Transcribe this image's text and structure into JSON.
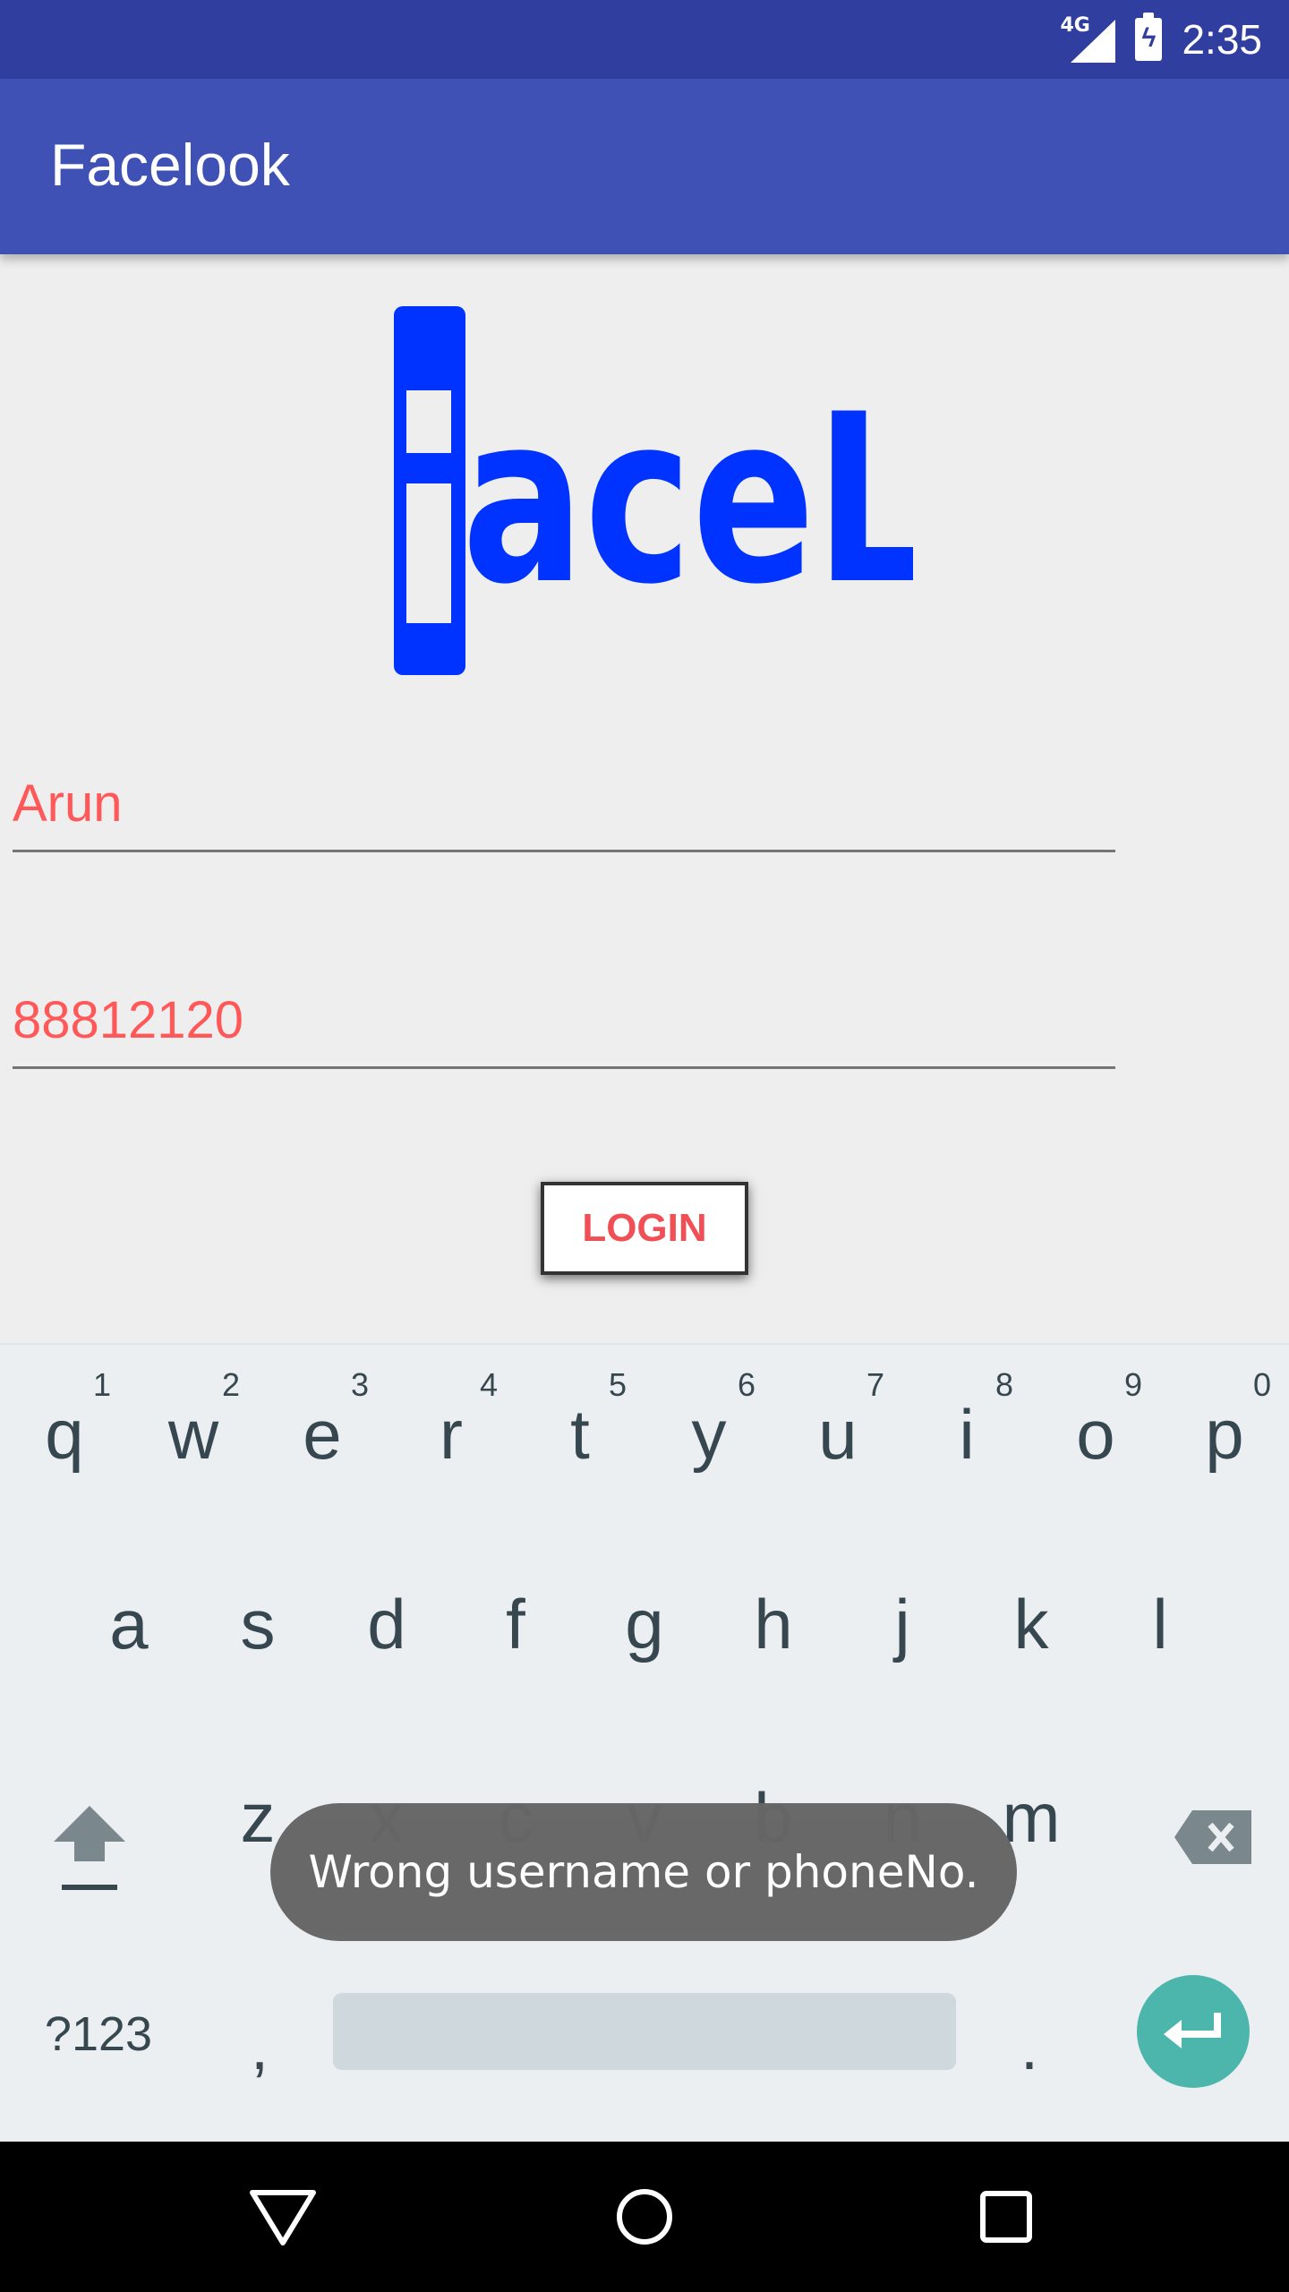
{
  "status_bar": {
    "network": "4G",
    "time": "2:35",
    "icons": [
      "signal-icon",
      "battery-charging-icon"
    ]
  },
  "app_bar": {
    "title": "Facelook"
  },
  "logo": {
    "text": "FaceLook",
    "color": "#0033ff"
  },
  "form": {
    "username_value": "Arun",
    "phone_value": "88812120",
    "login_label": "LOGIN",
    "text_color": "#ff5858"
  },
  "keyboard": {
    "row1": [
      {
        "key": "q",
        "hint": "1"
      },
      {
        "key": "w",
        "hint": "2"
      },
      {
        "key": "e",
        "hint": "3"
      },
      {
        "key": "r",
        "hint": "4"
      },
      {
        "key": "t",
        "hint": "5"
      },
      {
        "key": "y",
        "hint": "6"
      },
      {
        "key": "u",
        "hint": "7"
      },
      {
        "key": "i",
        "hint": "8"
      },
      {
        "key": "o",
        "hint": "9"
      },
      {
        "key": "p",
        "hint": "0"
      }
    ],
    "row2": [
      "a",
      "s",
      "d",
      "f",
      "g",
      "h",
      "j",
      "k",
      "l"
    ],
    "row3": [
      "z",
      "x",
      "c",
      "v",
      "b",
      "n",
      "m"
    ],
    "symbols_label": "?123",
    "comma": ",",
    "period": ".",
    "accent": "#4db6ac"
  },
  "toast": {
    "message": "Wrong username or phoneNo."
  },
  "nav_bar": {
    "icons": [
      "back-icon",
      "home-icon",
      "recents-icon"
    ]
  }
}
